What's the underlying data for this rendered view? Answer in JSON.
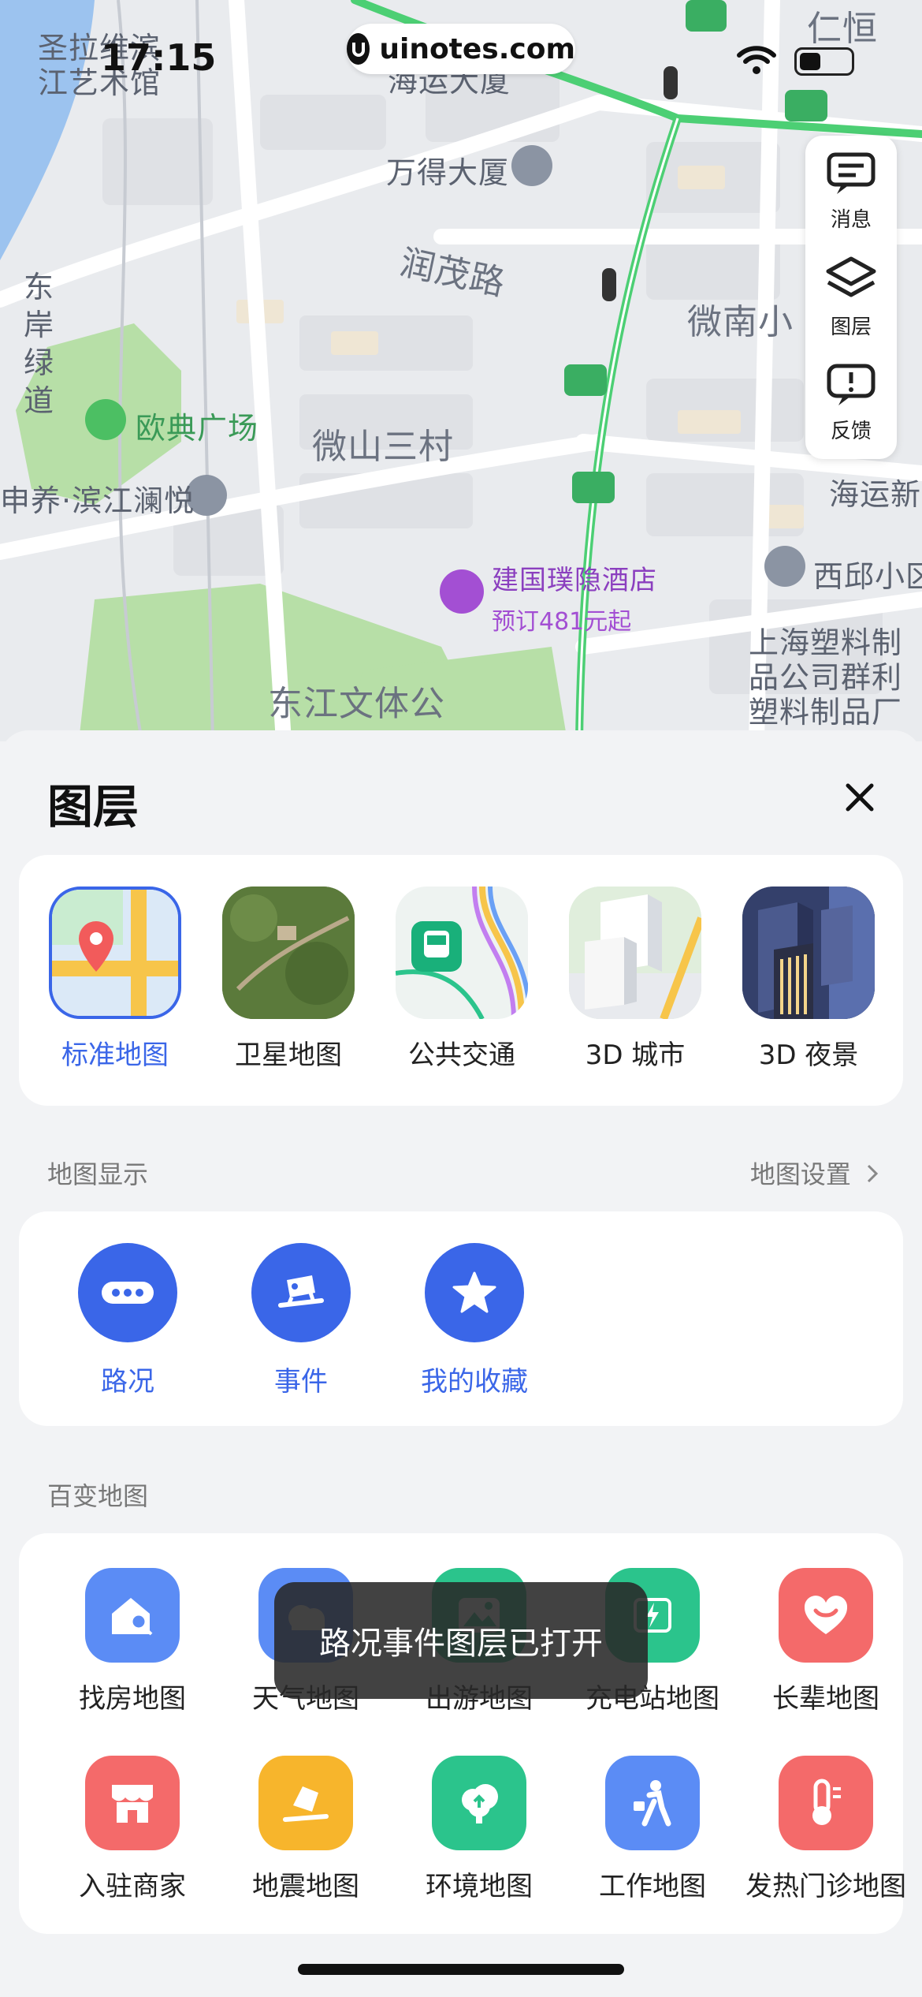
{
  "status_bar": {
    "time": "17:15",
    "watermark": "uinotes.com"
  },
  "map": {
    "labels": [
      {
        "id": "a",
        "text": "圣拉维滨"
      },
      {
        "id": "b",
        "text": "江艺术馆"
      },
      {
        "id": "c",
        "text": "海运大厦"
      },
      {
        "id": "d",
        "text": "万得大厦"
      },
      {
        "id": "e",
        "text": "润茂路"
      },
      {
        "id": "f",
        "text": "东岸绿道"
      },
      {
        "id": "g",
        "text": "欧典广场"
      },
      {
        "id": "h",
        "text": "微山三村"
      },
      {
        "id": "i",
        "text": "申养·滨江澜悦"
      },
      {
        "id": "j",
        "text": "微南小"
      },
      {
        "id": "k",
        "text": "海运新"
      },
      {
        "id": "l",
        "text": "西邱小区"
      },
      {
        "id": "m",
        "text": "上海塑料制"
      },
      {
        "id": "n",
        "text": "品公司群利"
      },
      {
        "id": "o",
        "text": "塑料制品厂"
      },
      {
        "id": "p",
        "text": "东江文体公"
      },
      {
        "id": "q",
        "text": "仁恒"
      }
    ],
    "hotel": {
      "name": "建国璞隐酒店",
      "price": "预订481元起"
    }
  },
  "side_panel": {
    "messages": "消息",
    "layers": "图层",
    "feedback": "反馈"
  },
  "sheet": {
    "title": "图层",
    "layers": [
      "标准地图",
      "卫星地图",
      "公共交通",
      "3D 城市",
      "3D 夜景"
    ],
    "display_section": "地图显示",
    "settings_link": "地图设置",
    "display_items": [
      "路况",
      "事件",
      "我的收藏"
    ],
    "variety_section": "百变地图",
    "variety_items": [
      {
        "label": "找房地图",
        "icon": "house-search-icon",
        "color": "#5b8cf5"
      },
      {
        "label": "天气地图",
        "icon": "weather-icon",
        "color": "#5b8cf5"
      },
      {
        "label": "出游地图",
        "icon": "travel-icon",
        "color": "#2bc48c"
      },
      {
        "label": "充电站地图",
        "icon": "charging-icon",
        "color": "#2bc48c"
      },
      {
        "label": "长辈地图",
        "icon": "heart-icon",
        "color": "#f46a6a"
      },
      {
        "label": "入驻商家",
        "icon": "shop-icon",
        "color": "#f46a6a"
      },
      {
        "label": "地震地图",
        "icon": "earthquake-icon",
        "color": "#f7b52c"
      },
      {
        "label": "环境地图",
        "icon": "tree-icon",
        "color": "#2bc48c"
      },
      {
        "label": "工作地图",
        "icon": "worker-icon",
        "color": "#5b8cf5"
      },
      {
        "label": "发热门诊地图",
        "icon": "thermometer-icon",
        "color": "#f46a6a"
      }
    ]
  },
  "toast": "路况事件图层已打开"
}
